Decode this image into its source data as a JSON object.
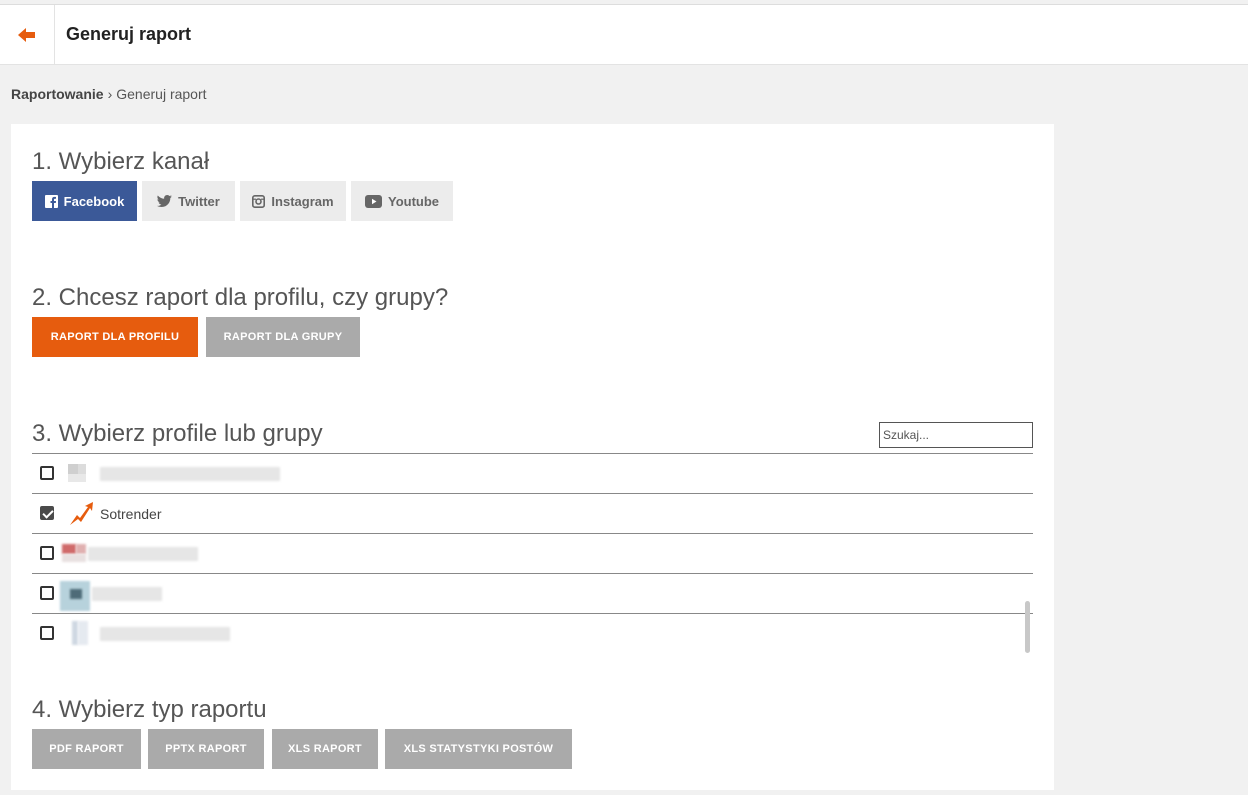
{
  "header": {
    "title": "Generuj raport"
  },
  "breadcrumb": {
    "root": "Raportowanie",
    "separator": "›",
    "current": "Generuj raport"
  },
  "sections": {
    "channel": {
      "title": "1. Wybierz kanał"
    },
    "type": {
      "title": "2. Chcesz raport dla profilu, czy grupy?"
    },
    "profiles": {
      "title": "3. Wybierz profile lub grupy"
    },
    "report": {
      "title": "4. Wybierz typ raportu"
    }
  },
  "channels": [
    {
      "label": "Facebook",
      "icon": "facebook-icon",
      "active": true
    },
    {
      "label": "Twitter",
      "icon": "twitter-icon",
      "active": false
    },
    {
      "label": "Instagram",
      "icon": "instagram-icon",
      "active": false
    },
    {
      "label": "Youtube",
      "icon": "youtube-icon",
      "active": false
    }
  ],
  "type_buttons": [
    {
      "label": "RAPORT DLA PROFILU",
      "active": true
    },
    {
      "label": "RAPORT DLA GRUPY",
      "active": false
    }
  ],
  "search": {
    "placeholder": "Szukaj..."
  },
  "profiles": [
    {
      "label": "",
      "checked": false
    },
    {
      "label": "Sotrender",
      "checked": true
    },
    {
      "label": "",
      "checked": false
    },
    {
      "label": "",
      "checked": false
    },
    {
      "label": "",
      "checked": false
    }
  ],
  "report_buttons": [
    {
      "label": "PDF RAPORT"
    },
    {
      "label": "PPTX RAPORT"
    },
    {
      "label": "XLS RAPORT"
    },
    {
      "label": "XLS STATYSTYKI POSTÓW"
    }
  ],
  "colors": {
    "accent": "#e65c0e",
    "facebook": "#3b5998",
    "inactive": "#aaaaaa"
  }
}
